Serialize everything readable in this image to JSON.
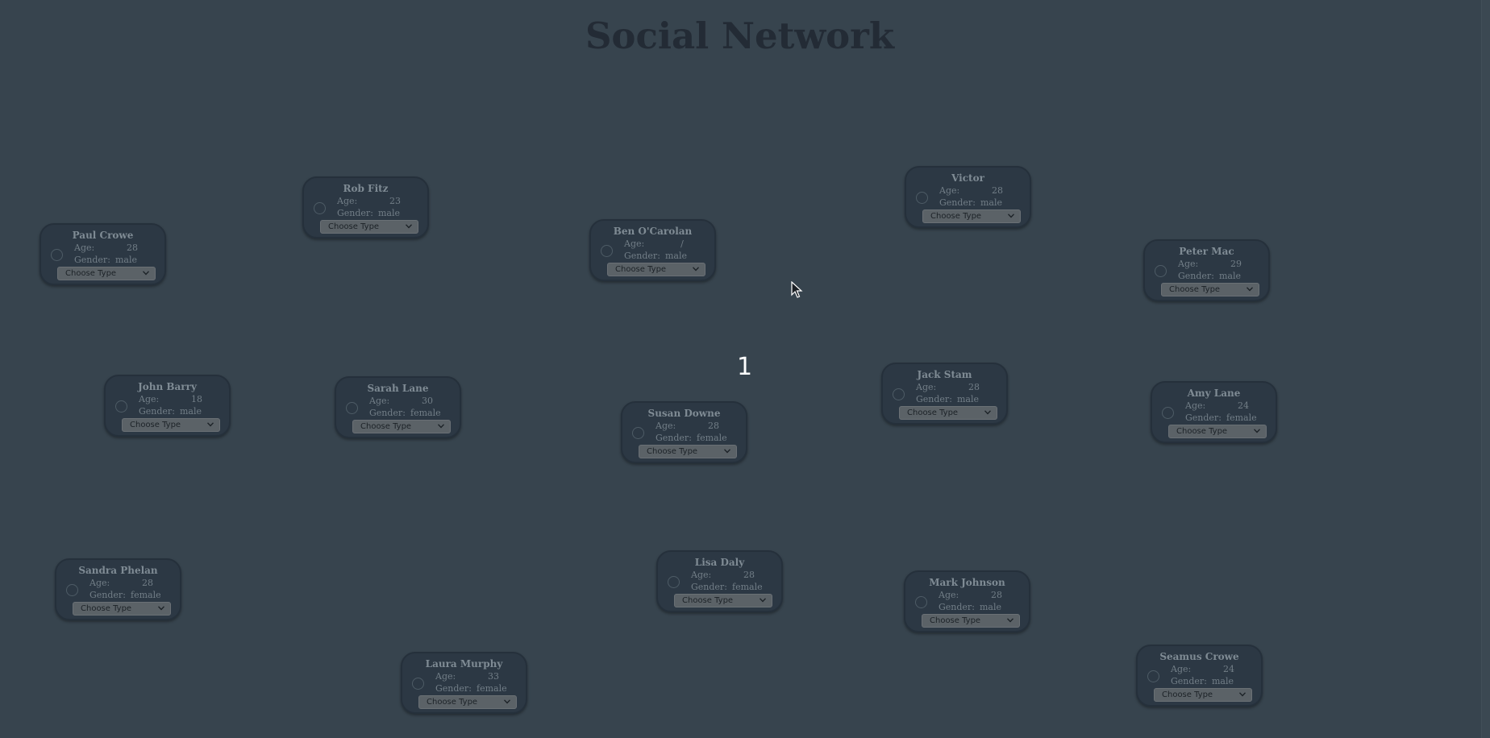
{
  "title": "Social Network",
  "count": "1",
  "labels": {
    "age": "Age:",
    "gender": "Gender:"
  },
  "select_placeholder": "Choose Type",
  "people": [
    {
      "name": "Paul Crowe",
      "age": "28",
      "gender": "male"
    },
    {
      "name": "Rob Fitz",
      "age": "23",
      "gender": "male"
    },
    {
      "name": "Ben O'Carolan",
      "age": "/",
      "gender": "male"
    },
    {
      "name": "Victor",
      "age": "28",
      "gender": "male"
    },
    {
      "name": "Peter Mac",
      "age": "29",
      "gender": "male"
    },
    {
      "name": "John Barry",
      "age": "18",
      "gender": "male"
    },
    {
      "name": "Sarah Lane",
      "age": "30",
      "gender": "female"
    },
    {
      "name": "Susan Downe",
      "age": "28",
      "gender": "female"
    },
    {
      "name": "Jack Stam",
      "age": "28",
      "gender": "male"
    },
    {
      "name": "Amy Lane",
      "age": "24",
      "gender": "female"
    },
    {
      "name": "Sandra Phelan",
      "age": "28",
      "gender": "female"
    },
    {
      "name": "Lisa Daly",
      "age": "28",
      "gender": "female"
    },
    {
      "name": "Mark Johnson",
      "age": "28",
      "gender": "male"
    },
    {
      "name": "Laura Murphy",
      "age": "33",
      "gender": "female"
    },
    {
      "name": "Seamus Crowe",
      "age": "24",
      "gender": "male"
    }
  ]
}
